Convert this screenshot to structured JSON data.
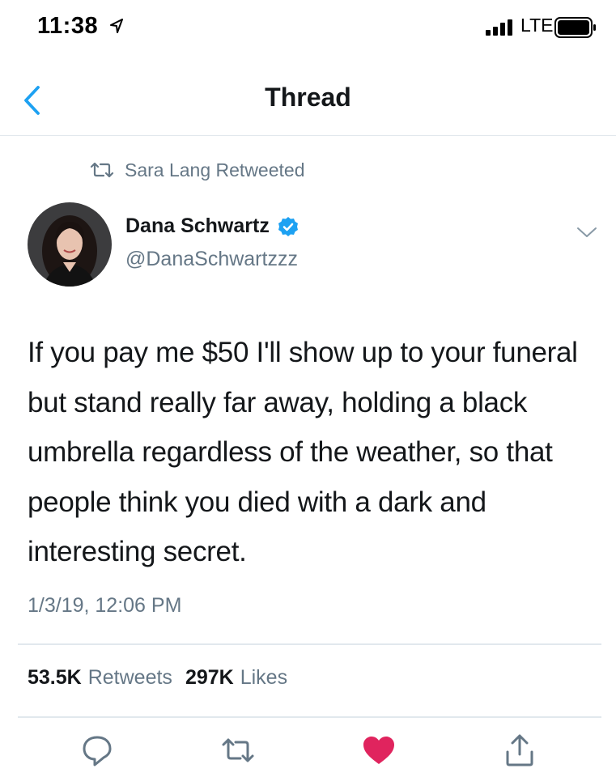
{
  "status_bar": {
    "time": "11:38",
    "network": "LTE",
    "icons": [
      "location-arrow-icon",
      "signal-bars-icon",
      "battery-icon"
    ]
  },
  "nav": {
    "title": "Thread",
    "back_icon": "chevron-left-icon",
    "accent_color": "#1da1f2"
  },
  "retweet_context": {
    "icon": "retweet-icon",
    "text": "Sara Lang Retweeted"
  },
  "tweet": {
    "author": {
      "name": "Dana Schwartz",
      "handle": "@DanaSchwartzzz",
      "verified": true,
      "verified_color": "#1da1f2"
    },
    "text": "If you pay me $50 I'll show up to your funeral but stand really far away, holding a black umbrella regardless of the weather, so that people think you died with a dark and interesting secret.",
    "timestamp": "1/3/19, 12:06 PM",
    "stats": {
      "retweets_count": "53.5K",
      "retweets_label": "Retweets",
      "likes_count": "297K",
      "likes_label": "Likes"
    },
    "liked": true,
    "like_color": "#e0245e"
  },
  "actions": [
    "reply-icon",
    "retweet-icon",
    "like-heart-icon",
    "share-icon"
  ]
}
